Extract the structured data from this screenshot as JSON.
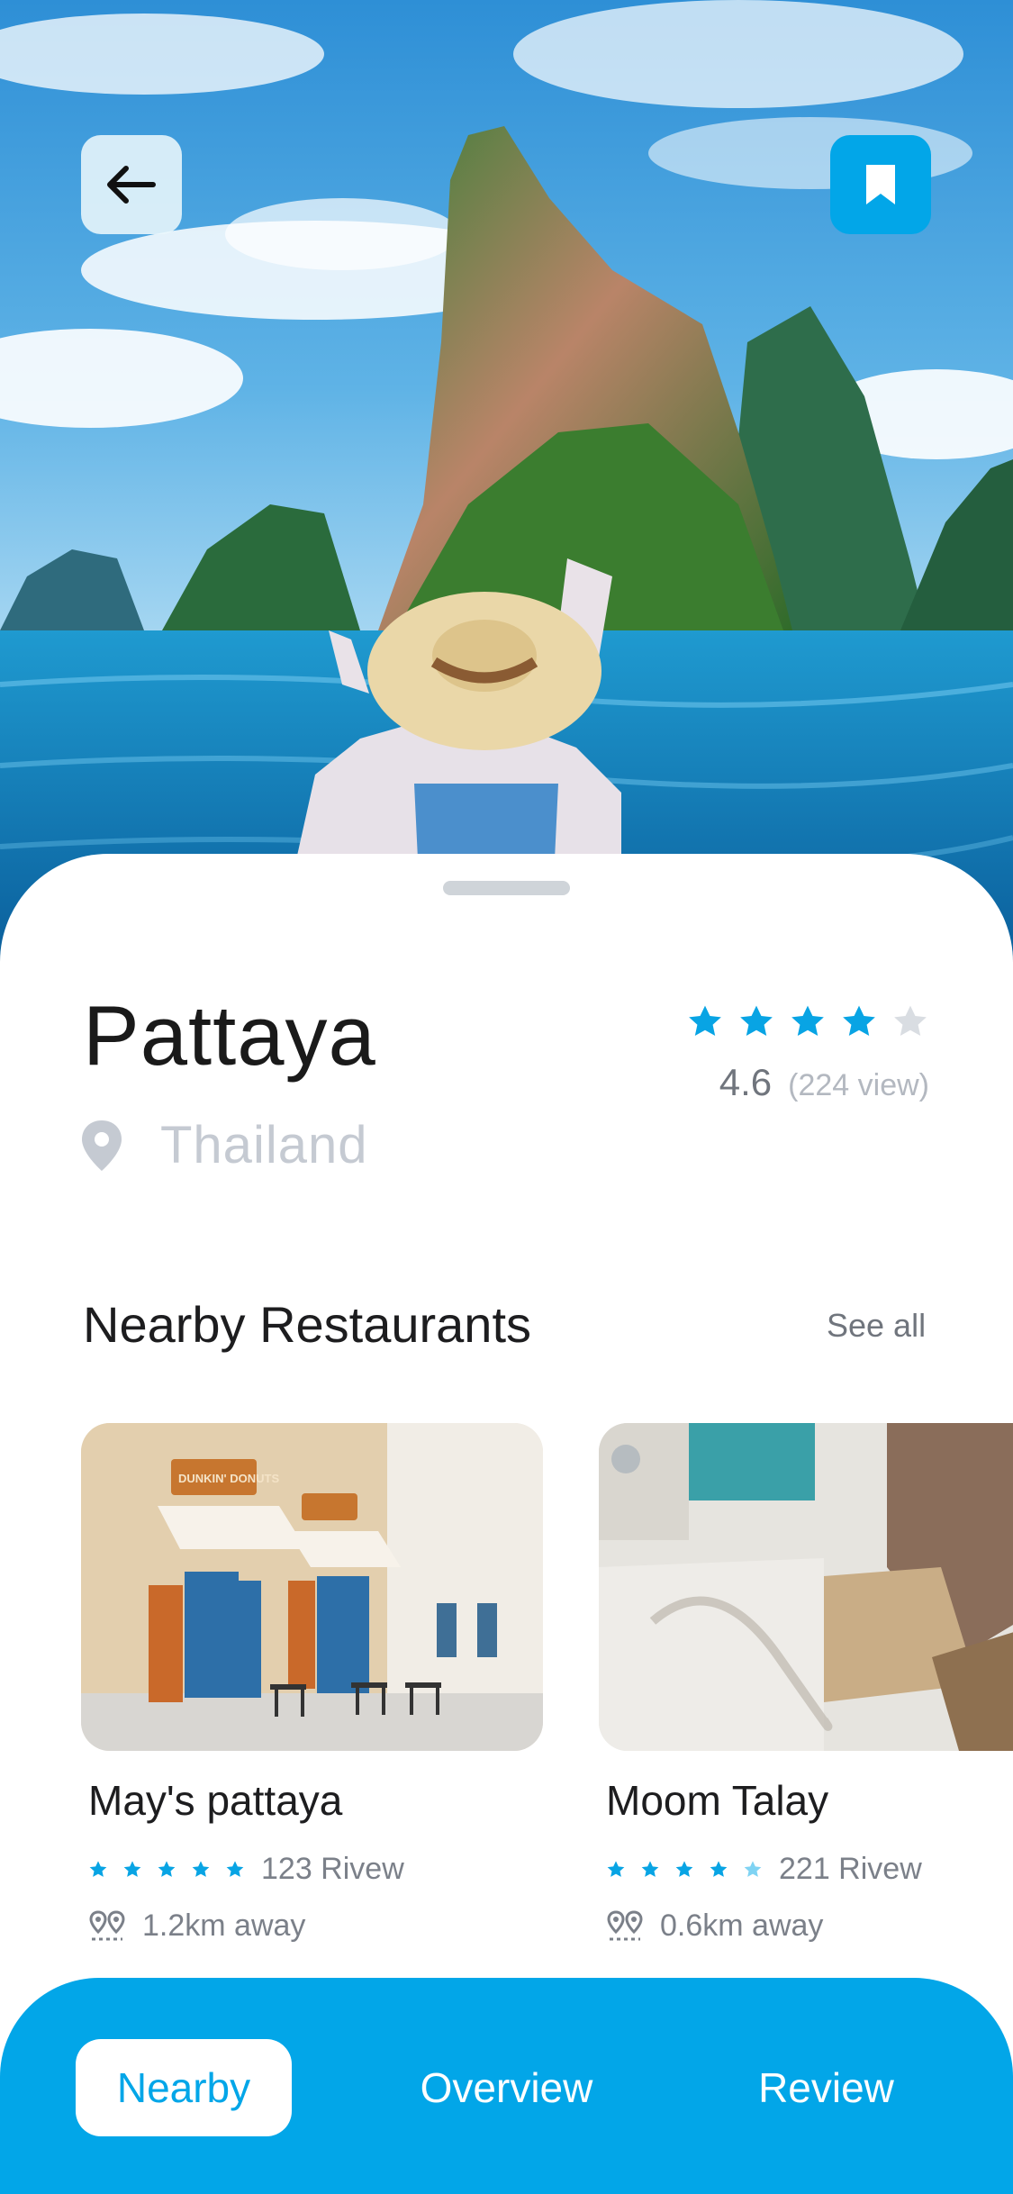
{
  "place": {
    "title": "Pattaya",
    "location": "Thailand",
    "rating_stars": 4,
    "rating_score": "4.6",
    "rating_views": "(224 view)"
  },
  "nearby": {
    "section_title": "Nearby Restaurants",
    "see_all": "See all",
    "cards": [
      {
        "name": "May's pattaya",
        "stars": 5,
        "reviews": "123 Rivew",
        "distance": "1.2km away"
      },
      {
        "name": "Moom Talay",
        "stars": 4,
        "reviews": "221 Rivew",
        "distance": "0.6km away"
      }
    ]
  },
  "tabs": [
    {
      "label": "Nearby",
      "active": true
    },
    {
      "label": "Overview",
      "active": false
    },
    {
      "label": "Review",
      "active": false
    }
  ],
  "icons": {
    "back": "arrow-left-icon",
    "bookmark": "bookmark-icon",
    "location": "location-pin-icon",
    "distance": "pins-distance-icon",
    "star": "star-icon"
  },
  "colors": {
    "accent": "#02a6e8",
    "star_active": "#08a4e4",
    "star_inactive": "#d9dde2",
    "star_partial": "#7fd3f3"
  },
  "shop_sign": "DUNKIN' DONUTS"
}
